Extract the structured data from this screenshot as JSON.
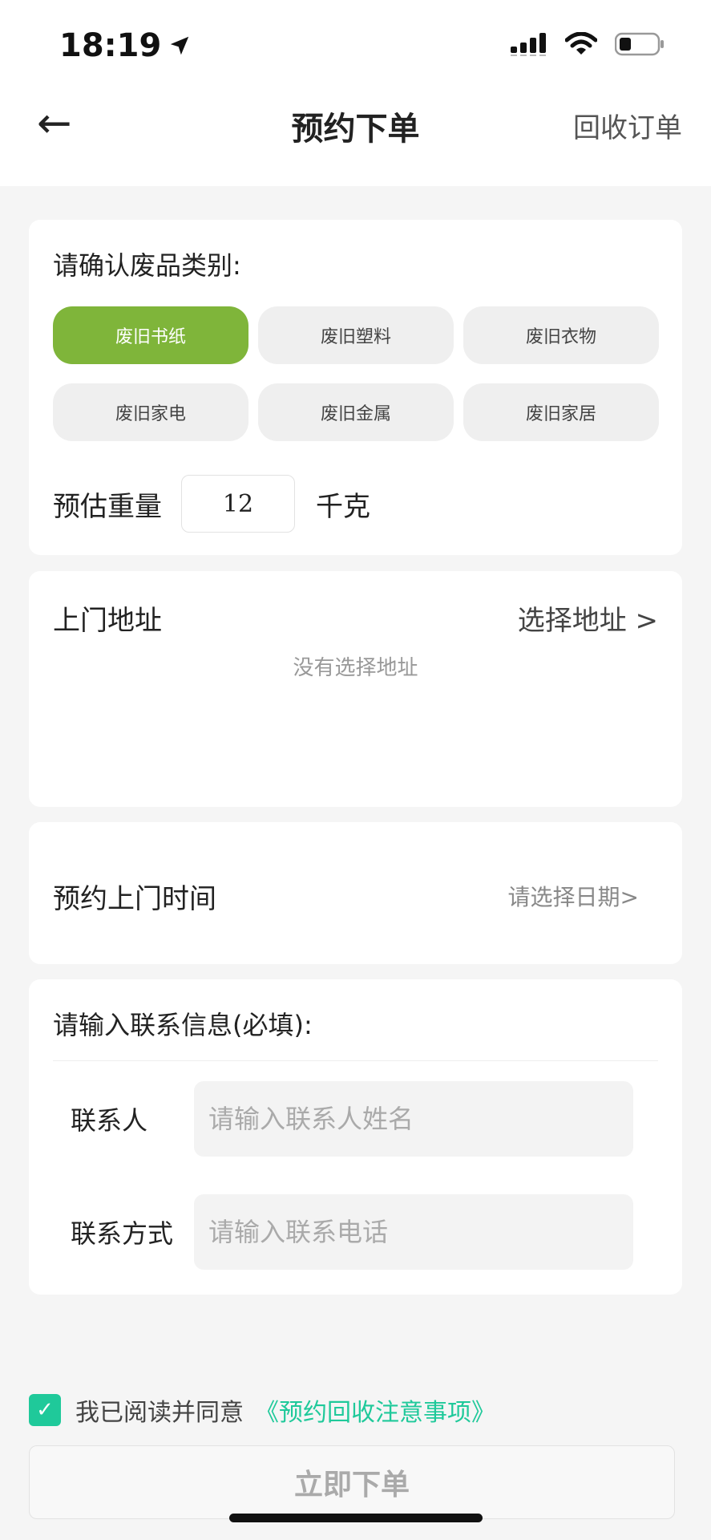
{
  "status_bar": {
    "time": "18:19"
  },
  "nav": {
    "back_glyph": "←",
    "title": "预约下单",
    "right_link": "回收订单"
  },
  "category": {
    "heading": "请确认废品类别:",
    "options": [
      {
        "label": "废旧书纸",
        "selected": true
      },
      {
        "label": "废旧塑料",
        "selected": false
      },
      {
        "label": "废旧衣物",
        "selected": false
      },
      {
        "label": "废旧家电",
        "selected": false
      },
      {
        "label": "废旧金属",
        "selected": false
      },
      {
        "label": "废旧家居",
        "selected": false
      }
    ],
    "selected_color": "#7fb53a"
  },
  "weight": {
    "label": "预估重量",
    "value": "12",
    "unit": "千克"
  },
  "address": {
    "label": "上门地址",
    "select_link": "选择地址 >",
    "empty_text": "没有选择地址"
  },
  "time": {
    "label": "预约上门时间",
    "select_link": "请选择日期>"
  },
  "contact": {
    "heading": "请输入联系信息(必填):",
    "name_label": "联系人",
    "name_placeholder": "请输入联系人姓名",
    "phone_label": "联系方式",
    "phone_placeholder": "请输入联系电话"
  },
  "agreement": {
    "checked": true,
    "check_glyph": "✓",
    "text": "我已阅读并同意",
    "link": "《预约回收注意事项》",
    "accent_color": "#1fc99a"
  },
  "submit": {
    "label": "立即下单"
  }
}
